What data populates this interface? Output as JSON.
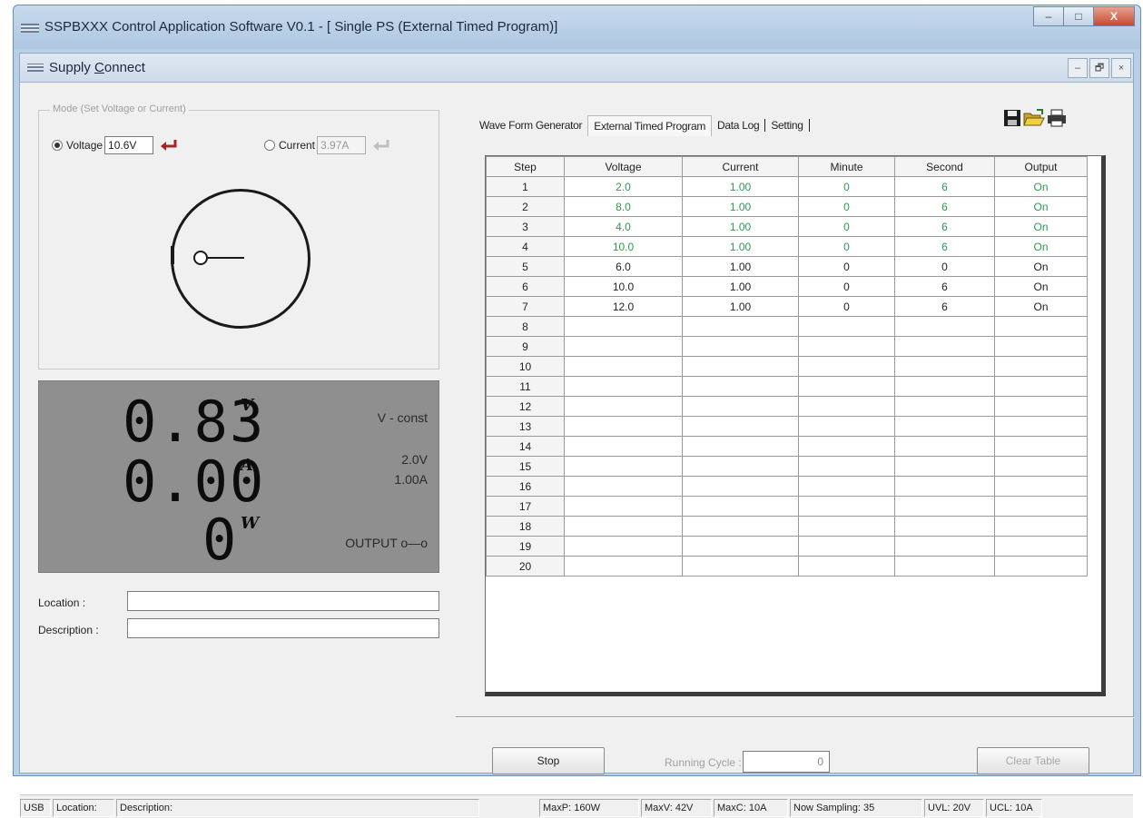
{
  "window": {
    "title": "SSPBXXX Control Application Software V0.1 - [ Single PS (External Timed Program)]",
    "minimize": "–",
    "maximize": "□",
    "close": "X"
  },
  "child": {
    "title_pre": "Supply ",
    "title_underlined": "C",
    "title_post": "onnect",
    "minimize": "–",
    "restore": "🗗",
    "close": "×"
  },
  "mode": {
    "legend": "Mode (Set Voltage or Current)",
    "voltage_label": "Voltage",
    "voltage_value": "10.6V",
    "current_label": "Current",
    "current_value": "3.97A",
    "selected": "voltage"
  },
  "display": {
    "voltage": "0.83",
    "voltage_unit": "V",
    "current": "0.00",
    "current_unit": "A",
    "power": "0",
    "power_unit": "W",
    "mode_text": "V - const",
    "set_voltage": "2.0V",
    "set_current": "1.00A",
    "output_text": "OUTPUT o—o"
  },
  "info": {
    "location_label": "Location :",
    "location_value": "",
    "description_label": "Description :",
    "description_value": ""
  },
  "tabs": [
    {
      "label": "Wave Form Generator"
    },
    {
      "label": "External Timed Program"
    },
    {
      "label": "Data Log"
    },
    {
      "label": "Setting"
    }
  ],
  "toolbar_icons": [
    "save-icon",
    "open-folder-icon",
    "print-icon"
  ],
  "table": {
    "headers": [
      "Step",
      "Voltage",
      "Current",
      "Minute",
      "Second",
      "Output"
    ],
    "rows": [
      {
        "step": "1",
        "voltage": "2.0",
        "current": "1.00",
        "minute": "0",
        "second": "6",
        "output": "On",
        "highlight": true
      },
      {
        "step": "2",
        "voltage": "8.0",
        "current": "1.00",
        "minute": "0",
        "second": "6",
        "output": "On",
        "highlight": true
      },
      {
        "step": "3",
        "voltage": "4.0",
        "current": "1.00",
        "minute": "0",
        "second": "6",
        "output": "On",
        "highlight": true
      },
      {
        "step": "4",
        "voltage": "10.0",
        "current": "1.00",
        "minute": "0",
        "second": "6",
        "output": "On",
        "highlight": true
      },
      {
        "step": "5",
        "voltage": "6.0",
        "current": "1.00",
        "minute": "0",
        "second": "0",
        "output": "On",
        "highlight": false
      },
      {
        "step": "6",
        "voltage": "10.0",
        "current": "1.00",
        "minute": "0",
        "second": "6",
        "output": "On",
        "highlight": false
      },
      {
        "step": "7",
        "voltage": "12.0",
        "current": "1.00",
        "minute": "0",
        "second": "6",
        "output": "On",
        "highlight": false
      },
      {
        "step": "8",
        "voltage": "",
        "current": "",
        "minute": "",
        "second": "",
        "output": "",
        "highlight": false
      },
      {
        "step": "9",
        "voltage": "",
        "current": "",
        "minute": "",
        "second": "",
        "output": "",
        "highlight": false
      },
      {
        "step": "10",
        "voltage": "",
        "current": "",
        "minute": "",
        "second": "",
        "output": "",
        "highlight": false
      },
      {
        "step": "11",
        "voltage": "",
        "current": "",
        "minute": "",
        "second": "",
        "output": "",
        "highlight": false
      },
      {
        "step": "12",
        "voltage": "",
        "current": "",
        "minute": "",
        "second": "",
        "output": "",
        "highlight": false
      },
      {
        "step": "13",
        "voltage": "",
        "current": "",
        "minute": "",
        "second": "",
        "output": "",
        "highlight": false
      },
      {
        "step": "14",
        "voltage": "",
        "current": "",
        "minute": "",
        "second": "",
        "output": "",
        "highlight": false
      },
      {
        "step": "15",
        "voltage": "",
        "current": "",
        "minute": "",
        "second": "",
        "output": "",
        "highlight": false
      },
      {
        "step": "16",
        "voltage": "",
        "current": "",
        "minute": "",
        "second": "",
        "output": "",
        "highlight": false
      },
      {
        "step": "17",
        "voltage": "",
        "current": "",
        "minute": "",
        "second": "",
        "output": "",
        "highlight": false
      },
      {
        "step": "18",
        "voltage": "",
        "current": "",
        "minute": "",
        "second": "",
        "output": "",
        "highlight": false
      },
      {
        "step": "19",
        "voltage": "",
        "current": "",
        "minute": "",
        "second": "",
        "output": "",
        "highlight": false
      },
      {
        "step": "20",
        "voltage": "",
        "current": "",
        "minute": "",
        "second": "",
        "output": "",
        "highlight": false
      }
    ]
  },
  "controls": {
    "stop_label": "Stop",
    "cycle_label": "Running Cycle :",
    "cycle_value": "0",
    "clear_label": "Clear Table"
  },
  "status": {
    "usb": "USB",
    "location": "Location:",
    "description": "Description:",
    "max_p": "MaxP: 160W",
    "max_v": "MaxV: 42V",
    "max_c": "MaxC: 10A",
    "sampling": "Now Sampling: 35",
    "uvl": "UVL: 20V",
    "ucl": "UCL: 10A"
  },
  "colors": {
    "highlight_text": "#2f9a52",
    "lcd_background": "#8f8f8f",
    "enter_arrow_active": "#a0262b",
    "enter_arrow_disabled": "#bfbfbf"
  }
}
